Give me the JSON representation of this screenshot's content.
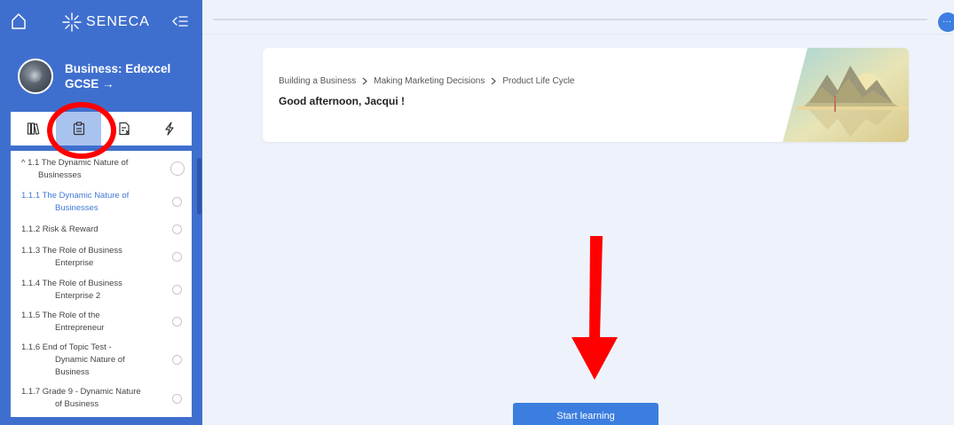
{
  "sidebar": {
    "brand": "SENECA",
    "course": {
      "title": "Business: Edexcel GCSE →"
    },
    "tabs": [
      {
        "icon": "book-icon",
        "active": false
      },
      {
        "icon": "clipboard-icon",
        "active": true
      },
      {
        "icon": "exam-icon",
        "active": false
      },
      {
        "icon": "lightning-icon",
        "active": false
      }
    ],
    "toc": [
      {
        "label": "^ 1.1 The Dynamic Nature of Businesses",
        "line1": "^ 1.1 The Dynamic Nature of",
        "line2": "Businesses",
        "active": false,
        "section": true
      },
      {
        "label": "1.1.1 The Dynamic Nature of Businesses",
        "line1": "1.1.1 The Dynamic Nature of",
        "line2": "Businesses",
        "active": true
      },
      {
        "label": "1.1.2 Risk & Reward",
        "line1": "1.1.2 Risk & Reward",
        "line2": "",
        "active": false
      },
      {
        "label": "1.1.3 The Role of Business Enterprise",
        "line1": "1.1.3 The Role of Business",
        "line2": "Enterprise",
        "active": false
      },
      {
        "label": "1.1.4 The Role of Business Enterprise 2",
        "line1": "1.1.4 The Role of Business",
        "line2": "Enterprise 2",
        "active": false
      },
      {
        "label": "1.1.5 The Role of the Entrepreneur",
        "line1": "1.1.5 The Role of the",
        "line2": "Entrepreneur",
        "active": false
      },
      {
        "label": "1.1.6 End of Topic Test - Dynamic Nature of Business",
        "line1": "1.1.6 End of Topic Test -",
        "line2": "Dynamic Nature of",
        "line3": "Business",
        "active": false
      },
      {
        "label": "1.1.7 Grade 9 - Dynamic Nature of Business",
        "line1": "1.1.7 Grade 9 - Dynamic Nature",
        "line2": "of Business",
        "active": false
      }
    ]
  },
  "header": {
    "breadcrumb": [
      "Building a Business",
      "Making Marketing Decisions",
      "Product Life Cycle"
    ],
    "greeting": "Good afternoon, Jacqui !"
  },
  "main": {
    "start_label": "Start learning",
    "more_label": "···"
  },
  "colors": {
    "sidebar": "#3f6fce",
    "accent": "#3c7ee0",
    "active_item": "#3f79d6",
    "annotation": "#ff0000"
  }
}
